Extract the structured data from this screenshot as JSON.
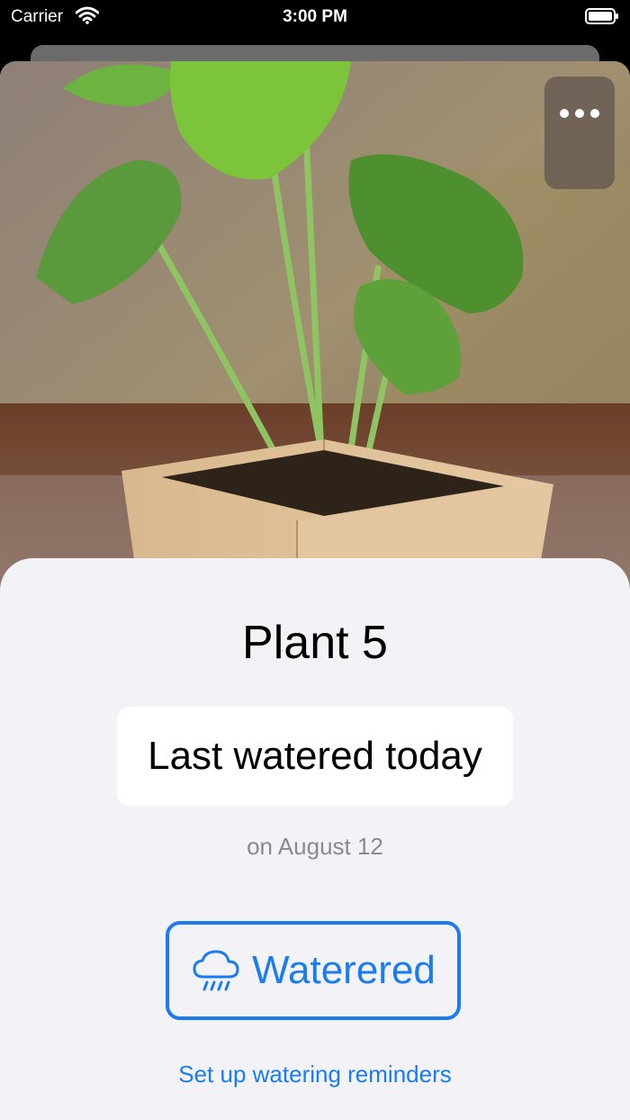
{
  "status_bar": {
    "carrier": "Carrier",
    "time": "3:00 PM"
  },
  "plant": {
    "name": "Plant 5",
    "watered_status": "Last watered today",
    "watered_date": "on August 12"
  },
  "actions": {
    "watered_label": "Waterered",
    "reminders_label": "Set up watering reminders"
  },
  "icons": {
    "more": "ellipsis-icon",
    "watered": "cloud-rain-icon",
    "wifi": "wifi-icon",
    "battery": "battery-icon"
  },
  "colors": {
    "accent": "#1a7cf0",
    "background": "#f2f2f7",
    "secondary_text": "#8a8a8e"
  }
}
